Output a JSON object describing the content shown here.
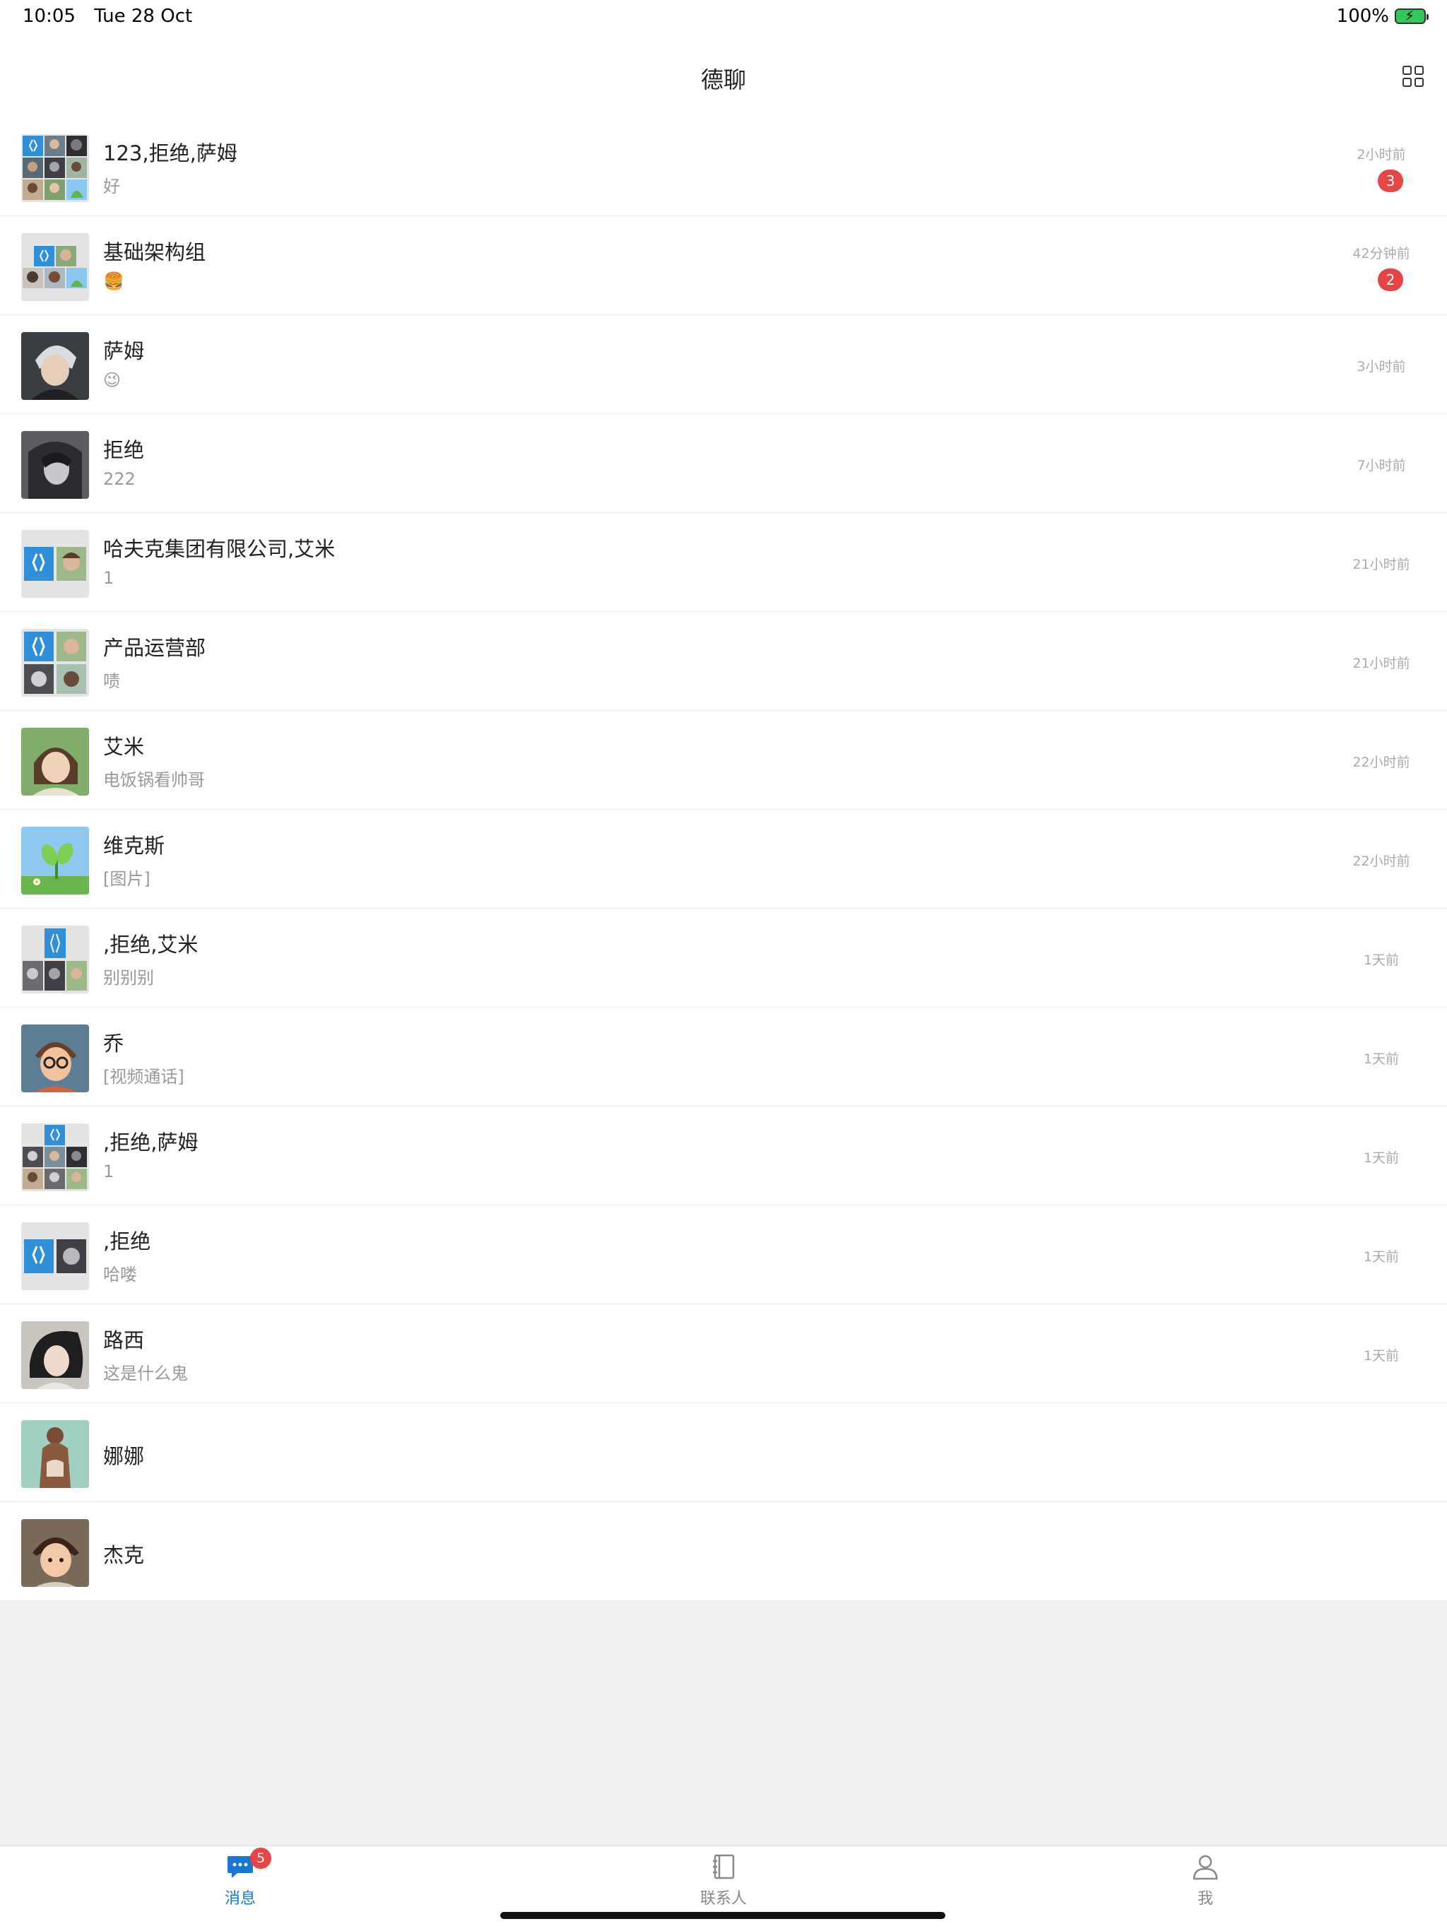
{
  "status_bar": {
    "time": "10:05",
    "date": "Tue 28 Oct",
    "battery": "100%"
  },
  "nav": {
    "title": "德聊",
    "menu_icon": "grid-icon"
  },
  "conversations": [
    {
      "name": "123,拒绝,萨姆",
      "preview": "好",
      "time": "2小时前",
      "badge": "3",
      "avatar": "group-grid-9"
    },
    {
      "name": "基础架构组",
      "preview": "🍔",
      "time": "42分钟前",
      "badge": "2",
      "avatar": "group-grid-4"
    },
    {
      "name": "萨姆",
      "preview": "😉",
      "time": "3小时前",
      "badge": "",
      "avatar": "boy-silver-hair"
    },
    {
      "name": "拒绝",
      "preview": "222",
      "time": "7小时前",
      "badge": "",
      "avatar": "dark-hair-portrait"
    },
    {
      "name": "哈夫克集团有限公司,艾米",
      "preview": "1",
      "time": "21小时前",
      "badge": "",
      "avatar": "group-grid-2"
    },
    {
      "name": "产品运营部",
      "preview": "啧",
      "time": "21小时前",
      "badge": "",
      "avatar": "group-grid-4b"
    },
    {
      "name": "艾米",
      "preview": "电饭锅看帅哥",
      "time": "22小时前",
      "badge": "",
      "avatar": "girl-portrait"
    },
    {
      "name": "维克斯",
      "preview": "[图片]",
      "time": "22小时前",
      "badge": "",
      "avatar": "plant-sky"
    },
    {
      "name": ",拒绝,艾米",
      "preview": "别别别",
      "time": "1天前",
      "badge": "",
      "avatar": "group-grid-3"
    },
    {
      "name": "乔",
      "preview": "[视频通话]",
      "time": "1天前",
      "badge": "",
      "avatar": "boy-glasses"
    },
    {
      "name": ",拒绝,萨姆",
      "preview": "1",
      "time": "1天前",
      "badge": "",
      "avatar": "group-grid-5"
    },
    {
      "name": ",拒绝",
      "preview": "哈喽",
      "time": "1天前",
      "badge": "",
      "avatar": "group-grid-2b"
    },
    {
      "name": "路西",
      "preview": "这是什么鬼",
      "time": "1天前",
      "badge": "",
      "avatar": "dark-hair-girl"
    },
    {
      "name": "娜娜",
      "preview": "",
      "time": "",
      "badge": "",
      "avatar": "girl-back"
    },
    {
      "name": "杰克",
      "preview": "",
      "time": "",
      "badge": "",
      "avatar": "boy-brown-hair"
    }
  ],
  "tab_bar": {
    "messages": {
      "label": "消息",
      "badge": "5"
    },
    "contacts": {
      "label": "联系人"
    },
    "me": {
      "label": "我"
    }
  },
  "colors": {
    "accent": "#1976d2",
    "badge": "#e54545",
    "background": "#f0f0f0"
  }
}
